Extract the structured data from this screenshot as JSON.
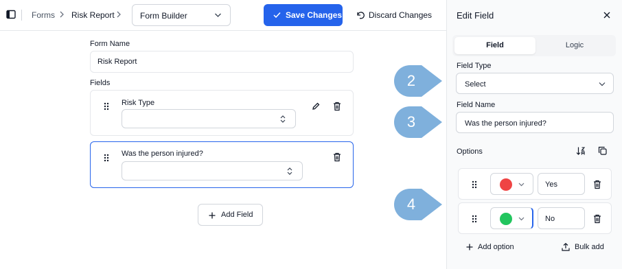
{
  "breadcrumb": {
    "forms": "Forms",
    "report": "Risk Report"
  },
  "view_select": {
    "value": "Form Builder"
  },
  "toolbar": {
    "save_label": "Save Changes",
    "discard_label": "Discard Changes"
  },
  "form": {
    "name_label": "Form Name",
    "name_value": "Risk Report",
    "fields_label": "Fields",
    "fields": [
      {
        "label": "Risk Type"
      },
      {
        "label": "Was the person injured?"
      }
    ],
    "add_field_label": "Add Field"
  },
  "callouts": [
    "2",
    "3",
    "4"
  ],
  "panel": {
    "title": "Edit Field",
    "tabs": {
      "field": "Field",
      "logic": "Logic"
    },
    "field_type_label": "Field Type",
    "field_type_value": "Select",
    "field_name_label": "Field Name",
    "field_name_value": "Was the person injured?",
    "options_label": "Options",
    "options": [
      {
        "value": "Yes",
        "color": "#ef4444"
      },
      {
        "value": "No",
        "color": "#22c55e"
      }
    ],
    "add_option_label": "Add option",
    "bulk_add_label": "Bulk add"
  },
  "colors": {
    "accent": "#2563eb",
    "callout": "#7fb0dc",
    "active_border": "#2563eb"
  },
  "icons": [
    "sidebar-toggle-icon",
    "chevron-right-icon",
    "chevron-down-icon",
    "check-icon",
    "undo-icon",
    "drag-handle-icon",
    "up-down-chevron-icon",
    "pencil-icon",
    "trash-icon",
    "plus-icon",
    "close-icon",
    "sort-icon",
    "copy-icon",
    "upload-icon"
  ]
}
